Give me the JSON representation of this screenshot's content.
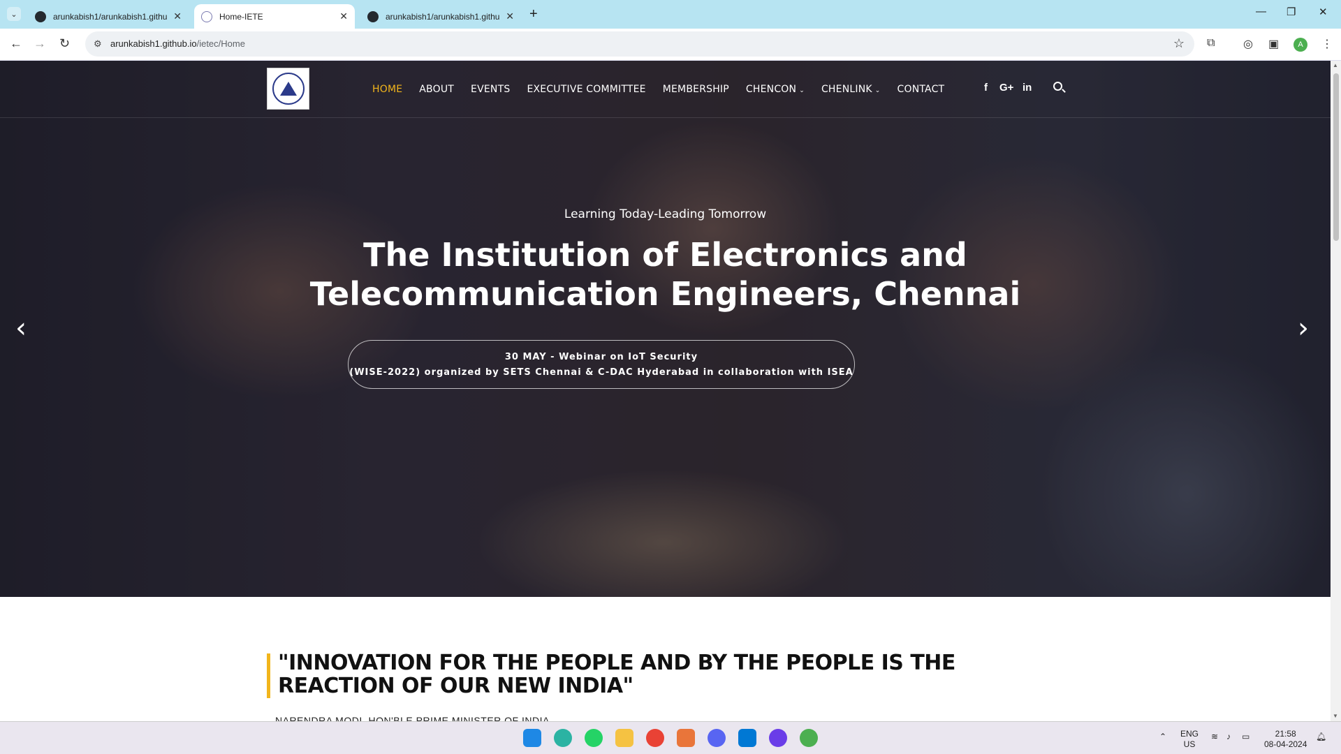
{
  "browser": {
    "tabs": [
      {
        "title": "arunkabish1/arunkabish1.githu",
        "active": false
      },
      {
        "title": "Home-IETE",
        "active": true
      },
      {
        "title": "arunkabish1/arunkabish1.githu",
        "active": false
      }
    ],
    "url_host": "arunkabish1.github.io",
    "url_path": "/ietec/Home",
    "profile_initial": "A"
  },
  "site": {
    "nav": {
      "items": [
        {
          "label": "HOME",
          "active": true
        },
        {
          "label": "ABOUT"
        },
        {
          "label": "EVENTS"
        },
        {
          "label": "EXECUTIVE COMMITTEE"
        },
        {
          "label": "MEMBERSHIP"
        },
        {
          "label": "CHENCON",
          "dropdown": true
        },
        {
          "label": "CHENLINK",
          "dropdown": true
        },
        {
          "label": "CONTACT"
        }
      ],
      "social": {
        "facebook": "f",
        "googleplus": "G+",
        "linkedin": "in"
      }
    },
    "hero": {
      "tagline": "Learning Today-Leading Tomorrow",
      "title_line1": "The Institution of Electronics and",
      "title_line2": "Telecommunication Engineers, Chennai",
      "news_line1": "30 MAY - Webinar on IoT Security",
      "news_line2": "(WISE-2022) organized by SETS Chennai & C-DAC Hyderabad in collaboration with ISEA",
      "prev": "‹",
      "next": "›"
    },
    "quote": {
      "text": "\"INNOVATION FOR THE PEOPLE AND BY THE PEOPLE IS THE REACTION OF OUR NEW INDIA\"",
      "author": "NARENDRA MODI, HON'BLE PRIME MINISTER OF INDIA"
    },
    "accent": "#f2b51c"
  },
  "taskbar": {
    "lang_line1": "ENG",
    "lang_line2": "US",
    "time": "21:58",
    "date": "08-04-2024"
  }
}
